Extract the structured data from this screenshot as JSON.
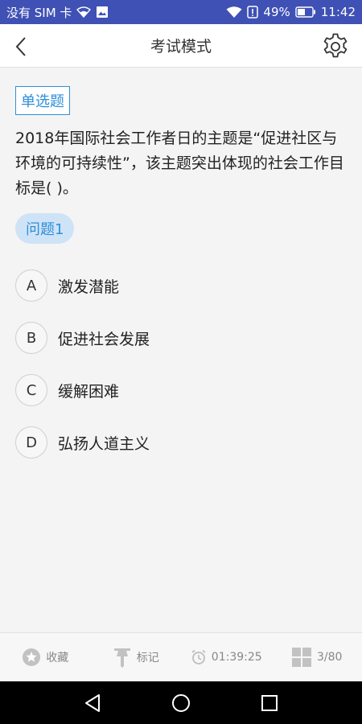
{
  "status_bar": {
    "carrier": "没有 SIM 卡",
    "battery": "49%",
    "time": "11:42"
  },
  "header": {
    "title": "考试模式"
  },
  "question": {
    "type": "单选题",
    "text": "2018年国际社会工作者日的主题是“促进社区与环境的可持续性”，该主题突出体现的社会工作目标是( )。",
    "number_label": "问题1",
    "options": [
      {
        "letter": "A",
        "text": "激发潜能"
      },
      {
        "letter": "B",
        "text": "促进社会发展"
      },
      {
        "letter": "C",
        "text": "缓解困难"
      },
      {
        "letter": "D",
        "text": "弘扬人道主义"
      }
    ]
  },
  "toolbar": {
    "favorite_label": "收藏",
    "mark_label": "标记",
    "timer": "01:39:25",
    "progress": "3/80"
  },
  "colors": {
    "status_bar": "#3f51b5",
    "accent": "#2e8fd8",
    "badge_bg": "#cfe3f7"
  }
}
